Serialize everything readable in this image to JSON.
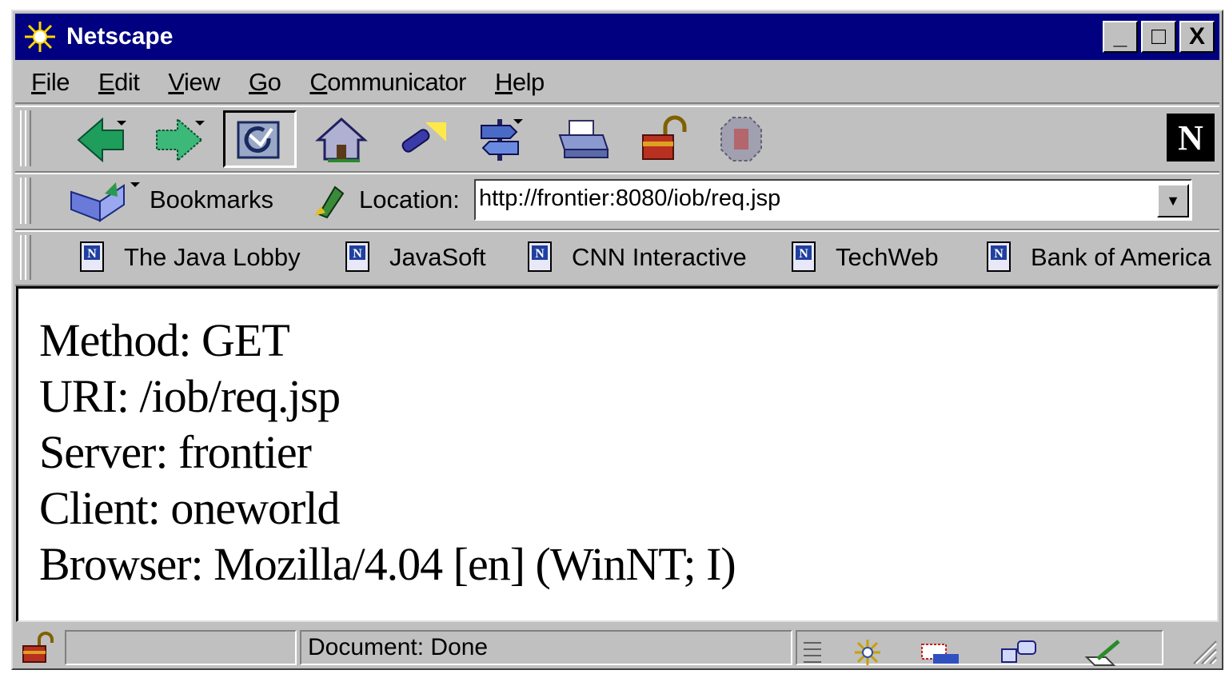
{
  "window": {
    "title": "Netscape",
    "controls": [
      "_",
      "□",
      "X"
    ]
  },
  "menu": [
    "File",
    "Edit",
    "View",
    "Go",
    "Communicator",
    "Help"
  ],
  "location": {
    "bookmarks_label": "Bookmarks",
    "location_label": "Location:",
    "url": "http://frontier:8080/iob/req.jsp"
  },
  "personal_toolbar": [
    "The Java Lobby",
    "JavaSoft",
    "CNN Interactive",
    "TechWeb",
    "Bank of America"
  ],
  "content": {
    "lines": [
      "Method: GET",
      "URI: /iob/req.jsp",
      "Server: frontier",
      "Client: oneworld",
      "Browser: Mozilla/4.04 [en] (WinNT; I)"
    ]
  },
  "status": {
    "text": "Document: Done"
  },
  "logo_letter": "N"
}
